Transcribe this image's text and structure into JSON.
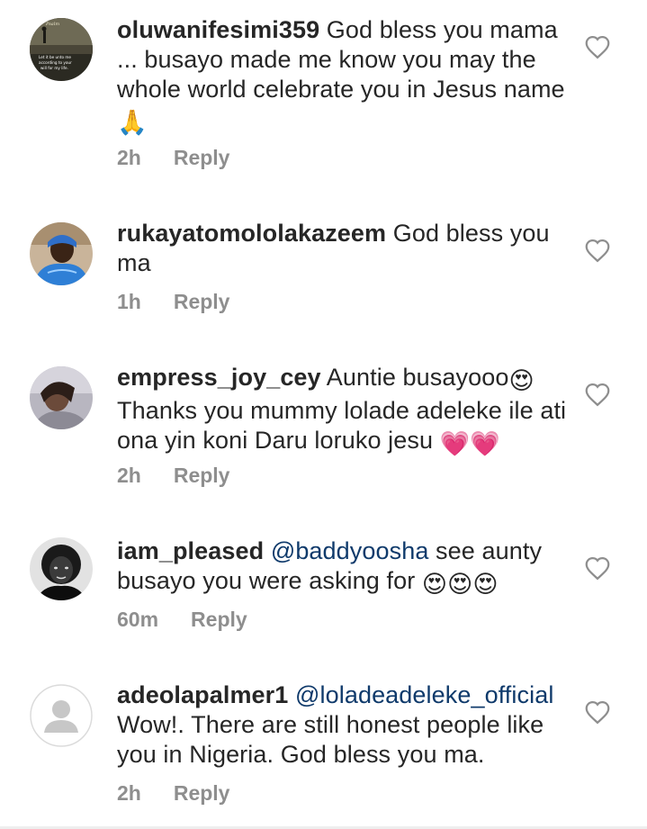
{
  "comments": [
    {
      "username": "oluwanifesimi359",
      "text": " God bless you mama ... busayo made me know you may the whole world celebrate you in Jesus name ",
      "emoji": "🙏",
      "time": "2h",
      "reply": "Reply",
      "avatar_text": "Let it be unto me according to your will for my life."
    },
    {
      "username": "rukayatomololakazeem",
      "text": " God bless you ma",
      "time": "1h",
      "reply": "Reply"
    },
    {
      "username": "empress_joy_cey",
      "text_a": " Auntie busayooo",
      "emoji_a": "😍",
      "text_b": " Thanks you mummy lolade adeleke ile ati ona yin koni Daru loruko jesu ",
      "emoji_b": "💗💗",
      "time": "2h",
      "reply": "Reply"
    },
    {
      "username": "iam_pleased",
      "mention": "@baddyoosha",
      "text": " see aunty busayo you were asking for ",
      "emoji": "😍😍😍",
      "time": "60m",
      "reply": "Reply"
    },
    {
      "username": "adeolapalmer1",
      "mention": "@loladeadeleke_official",
      "text": "Wow!. There are still honest people like you in Nigeria. God bless you ma.",
      "time": "2h",
      "reply": "Reply"
    }
  ],
  "colors": {
    "text": "#262626",
    "meta": "#8e8e8e",
    "mention": "#0f3a6b",
    "heart_outline": "#8e8e8e"
  }
}
